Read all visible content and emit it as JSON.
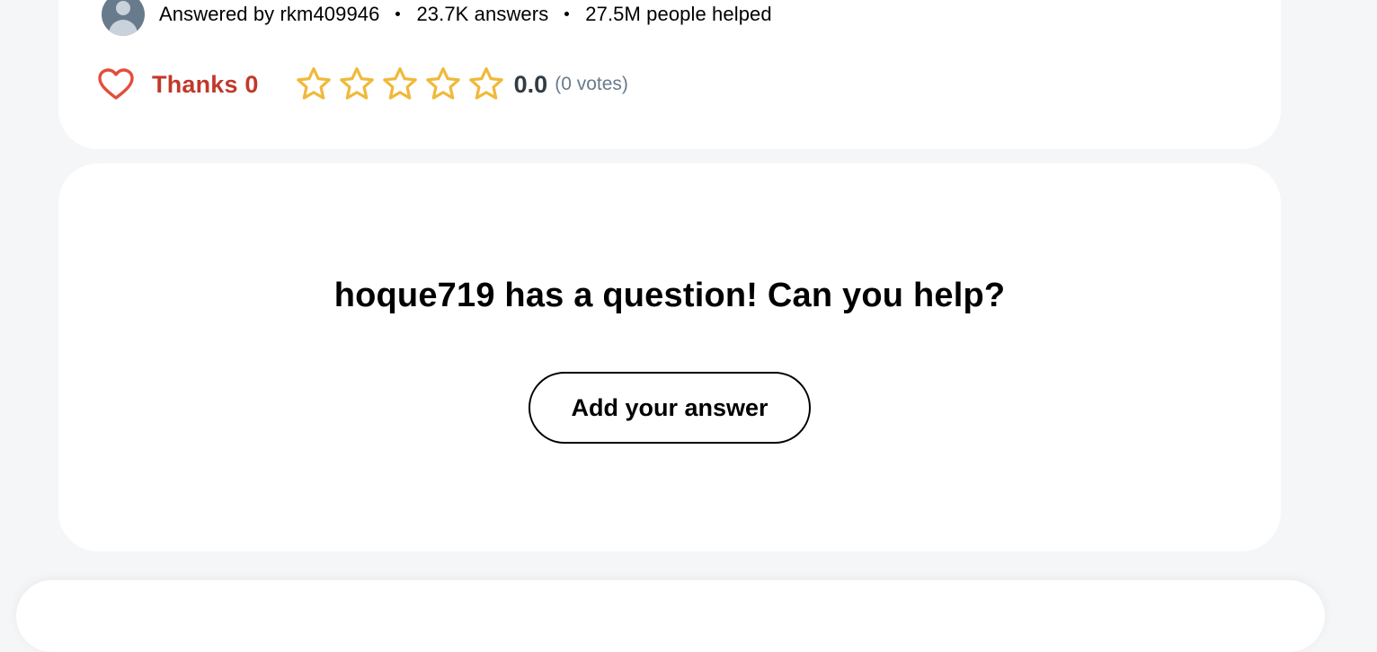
{
  "answer_card": {
    "author": {
      "answered_by": "Answered by rkm409946",
      "answers": "23.7K answers",
      "people_helped": "27.5M people helped"
    },
    "thanks": {
      "label": "Thanks 0",
      "icon": "heart-outline-icon",
      "color": "#c0392b"
    },
    "rating": {
      "stars_filled": 0,
      "stars_total": 5,
      "star_color": "#f0b93a",
      "value": "0.0",
      "votes": "(0 votes)"
    }
  },
  "ask_card": {
    "title": "hoque719 has a question! Can you help?",
    "button_label": "Add your answer"
  }
}
